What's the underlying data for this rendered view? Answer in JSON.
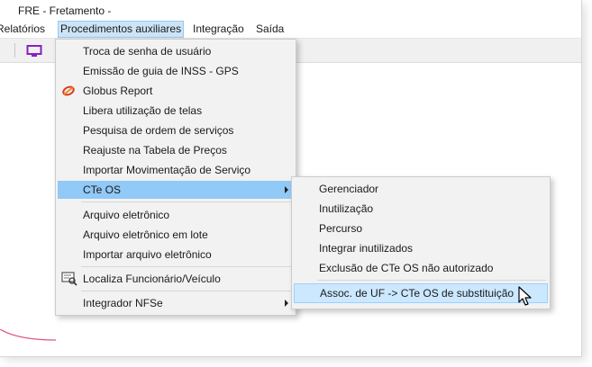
{
  "window": {
    "title": "FRE - Fretamento -"
  },
  "menubar": {
    "items": [
      {
        "label": "Relatórios"
      },
      {
        "label": "Procedimentos auxiliares"
      },
      {
        "label": "Integração"
      },
      {
        "label": "Saída"
      }
    ]
  },
  "toolbar": {
    "icons": [
      "monitor-icon"
    ]
  },
  "main_menu": {
    "items": [
      {
        "label": "Troca de senha de usuário"
      },
      {
        "label": "Emissão de guia de INSS - GPS"
      },
      {
        "label": "Globus Report",
        "icon": "globus-report-icon"
      },
      {
        "label": "Libera utilização de telas"
      },
      {
        "label": "Pesquisa de ordem de serviços"
      },
      {
        "label": "Reajuste na Tabela de Preços"
      },
      {
        "label": "Importar Movimentação de Serviço"
      },
      {
        "label": "CTe OS",
        "submenu": true,
        "highlighted": true
      },
      {
        "label": "Arquivo eletrônico"
      },
      {
        "label": "Arquivo eletrônico em lote"
      },
      {
        "label": "Importar arquivo eletrônico"
      },
      {
        "label": "Localiza Funcionário/Veículo",
        "icon": "search-employee-icon"
      },
      {
        "label": "Integrador NFSe",
        "submenu": true
      }
    ]
  },
  "cte_submenu": {
    "items": [
      {
        "label": "Gerenciador"
      },
      {
        "label": "Inutilização"
      },
      {
        "label": "Percurso"
      },
      {
        "label": "Integrar inutilizados"
      },
      {
        "label": "Exclusão de CTe OS não autorizado"
      },
      {
        "label": "Assoc. de UF -> CTe OS de substituição",
        "highlighted": true
      }
    ]
  },
  "colors": {
    "highlight_blue": "#91c9f7",
    "highlight_light": "#cce8ff",
    "menu_bg": "#f2f2f2",
    "accent_purple": "#8a1fc0"
  }
}
